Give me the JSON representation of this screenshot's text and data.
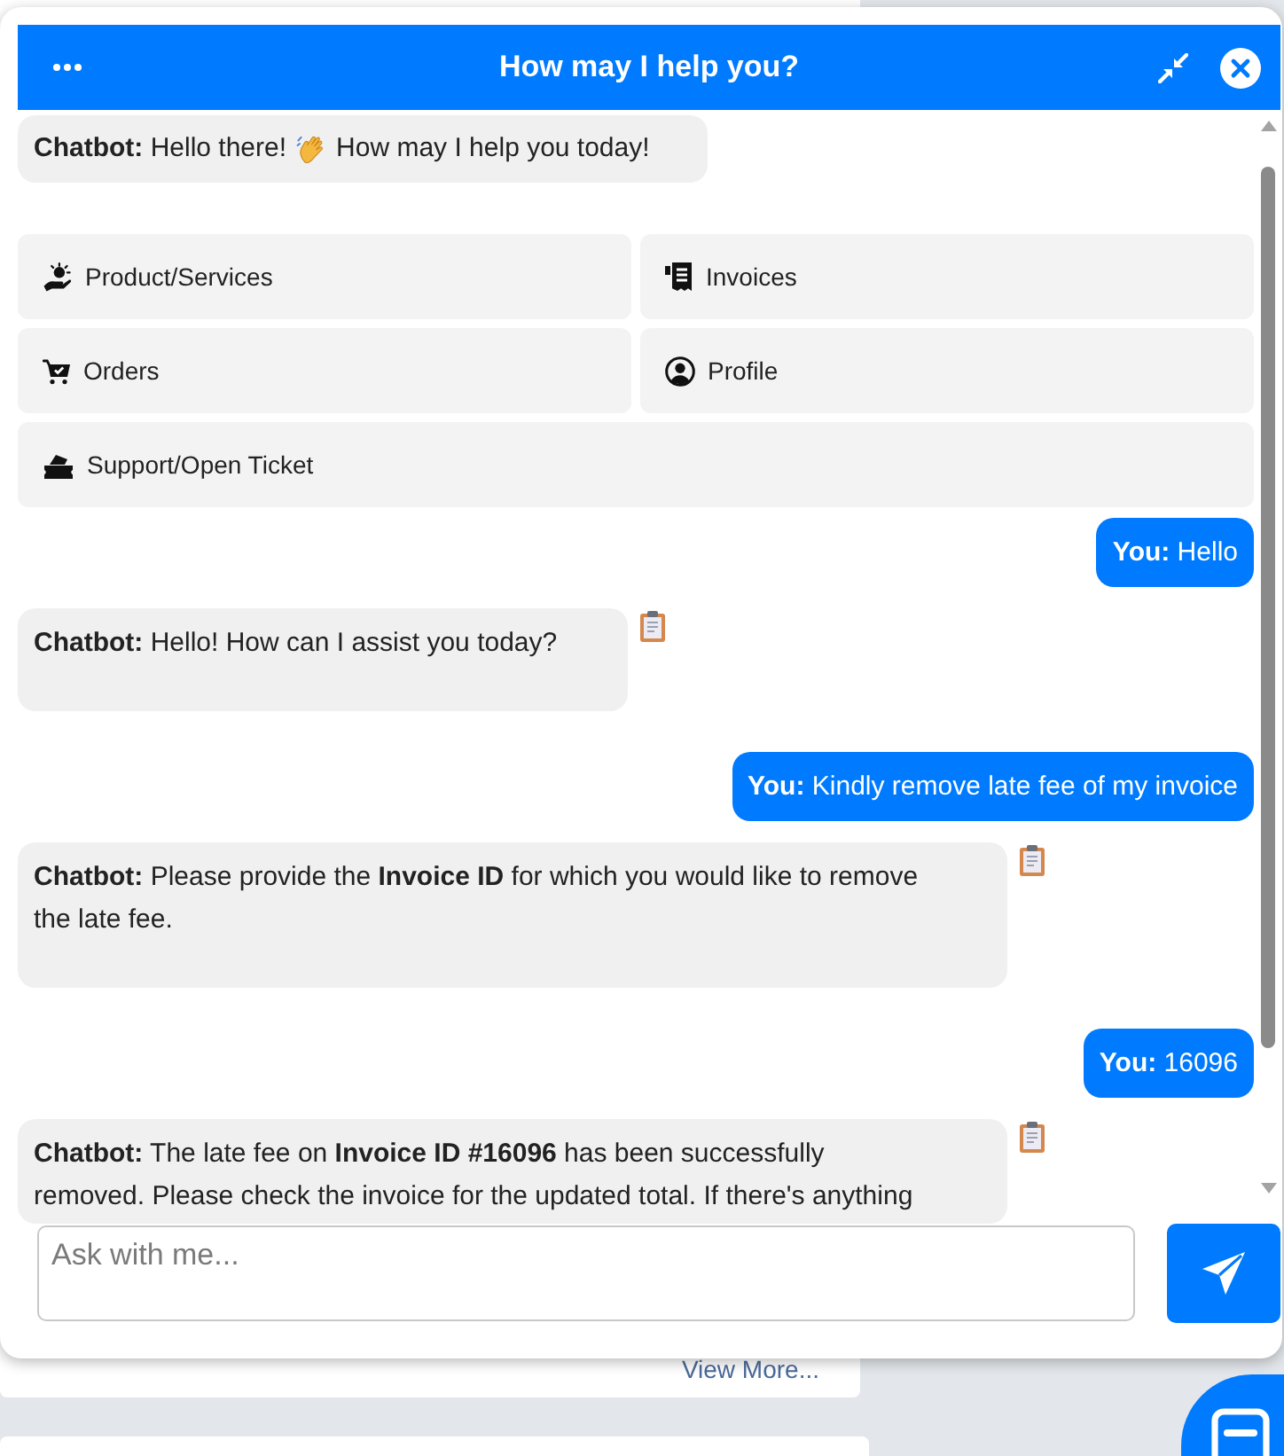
{
  "header": {
    "title": "How may I help you?"
  },
  "greeting": {
    "parts": [
      {
        "kind": "text",
        "text": "**Chatbot:** Hello there!"
      },
      {
        "kind": "emoji"
      },
      {
        "kind": "text",
        "text": "How may I help you today!"
      }
    ]
  },
  "quick_options": [
    {
      "label": "Product/Services"
    },
    {
      "label": "Invoices"
    },
    {
      "label": "Orders"
    },
    {
      "label": "Profile"
    },
    {
      "label": "Support/Open Ticket"
    }
  ],
  "messages": [
    {
      "kind": "user",
      "text": "**You:** Hello"
    },
    {
      "kind": "bot",
      "text": "**Chatbot:** Hello! How can I assist you today?"
    },
    {
      "kind": "user",
      "text": "**You:** Kindly remove late fee of my invoice"
    },
    {
      "kind": "bot",
      "text": "**Chatbot:** Please provide the **Invoice ID** for which you would like to remove the late fee."
    },
    {
      "kind": "user",
      "text": "**You:** 16096"
    },
    {
      "kind": "bot",
      "text": "**Chatbot:** The late fee on **Invoice ID #16096** has been successfully removed. Please check the invoice for the updated total. If there's anything"
    }
  ],
  "composer": {
    "placeholder": "Ask with me..."
  },
  "background": {
    "link": "View More..."
  }
}
